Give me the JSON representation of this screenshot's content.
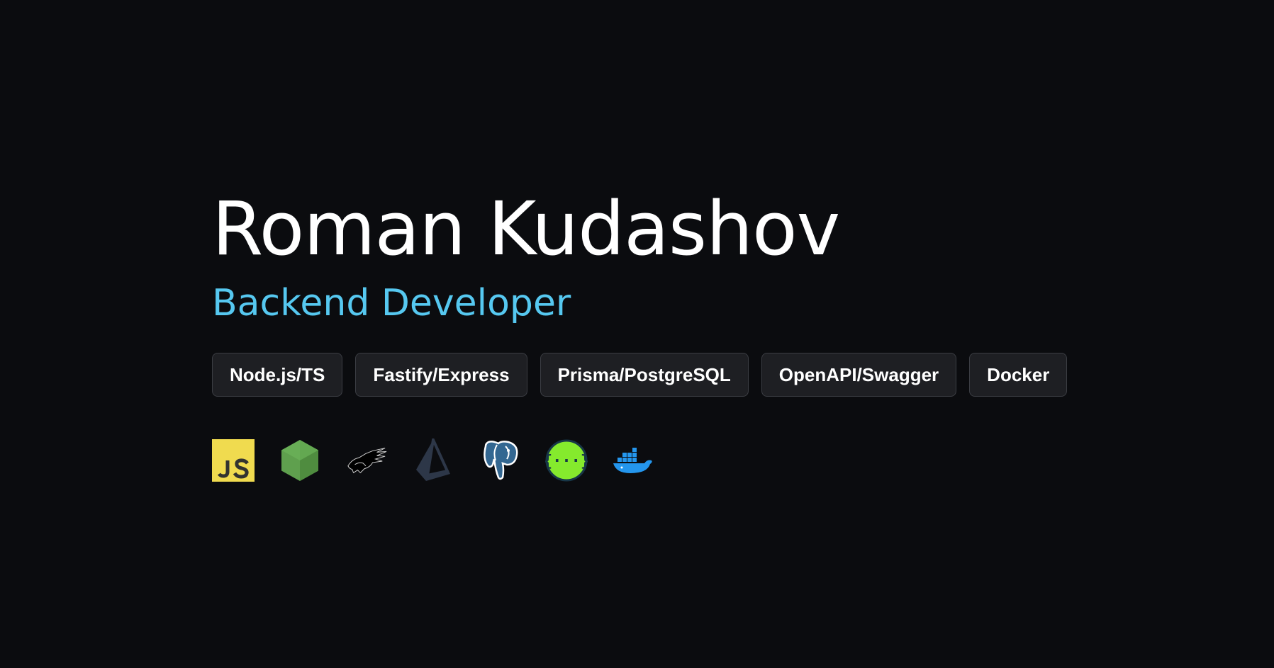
{
  "profile": {
    "name": "Roman Kudashov",
    "role": "Backend Developer"
  },
  "skills": [
    "Node.js/TS",
    "Fastify/Express",
    "Prisma/PostgreSQL",
    "OpenAPI/Swagger",
    "Docker"
  ],
  "tech_icons": [
    {
      "icon": "javascript-icon",
      "color": "#f0db4f"
    },
    {
      "icon": "nodejs-icon",
      "color": "#5fa04e"
    },
    {
      "icon": "fastify-icon",
      "color": "#000000"
    },
    {
      "icon": "prisma-icon",
      "color": "#2d3748"
    },
    {
      "icon": "postgresql-icon",
      "color": "#336791"
    },
    {
      "icon": "swagger-icon",
      "color": "#85ea2d"
    },
    {
      "icon": "docker-icon",
      "color": "#2496ed"
    }
  ],
  "colors": {
    "background": "#0b0c0f",
    "accent": "#56c8f0",
    "chip_background": "#1e1f23",
    "chip_border": "#3b3d43"
  }
}
